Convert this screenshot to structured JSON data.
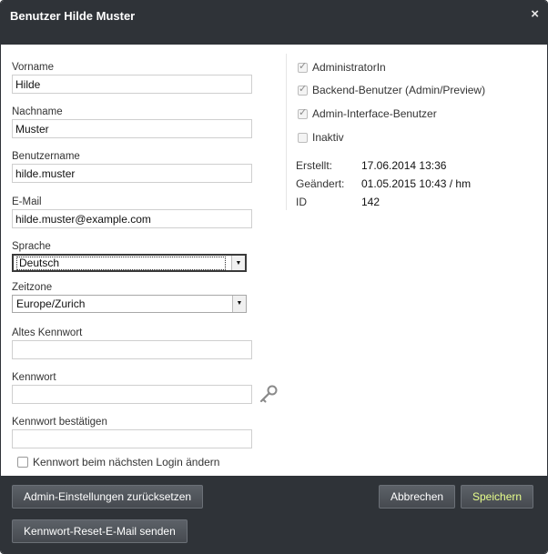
{
  "dialog": {
    "title": "Benutzer Hilde Muster",
    "close_glyph": "×"
  },
  "form": {
    "firstname_label": "Vorname",
    "firstname_value": "Hilde",
    "lastname_label": "Nachname",
    "lastname_value": "Muster",
    "username_label": "Benutzername",
    "username_value": "hilde.muster",
    "email_label": "E-Mail",
    "email_value": "hilde.muster@example.com",
    "language_label": "Sprache",
    "language_value": "Deutsch",
    "timezone_label": "Zeitzone",
    "timezone_value": "Europe/Zurich",
    "old_password_label": "Altes Kennwort",
    "old_password_value": "",
    "password_label": "Kennwort",
    "password_value": "",
    "password_confirm_label": "Kennwort bestätigen",
    "password_confirm_value": "",
    "change_password_next_login_label": "Kennwort beim nächsten Login ändern",
    "change_password_next_login_checked": false
  },
  "roles": [
    {
      "label": "AdministratorIn",
      "checked": true
    },
    {
      "label": "Backend-Benutzer (Admin/Preview)",
      "checked": true
    },
    {
      "label": "Admin-Interface-Benutzer",
      "checked": true
    },
    {
      "label": "Inaktiv",
      "checked": false
    }
  ],
  "info": {
    "created_label": "Erstellt:",
    "created_value": "17.06.2014 13:36",
    "changed_label": "Geändert:",
    "changed_value": "01.05.2015 10:43 / hm",
    "id_label": "ID",
    "id_value": "142"
  },
  "footer": {
    "reset_settings_label": "Admin-Einstellungen zurücksetzen",
    "send_reset_mail_label": "Kennwort-Reset-E-Mail senden",
    "cancel_label": "Abbrechen",
    "save_label": "Speichern"
  },
  "colors": {
    "dark_bar": "#2f3338",
    "save_text": "#e8ff8c"
  },
  "icons": {
    "close": "close-icon",
    "password_generator": "key-icon",
    "dropdown": "chevron-down-icon"
  }
}
